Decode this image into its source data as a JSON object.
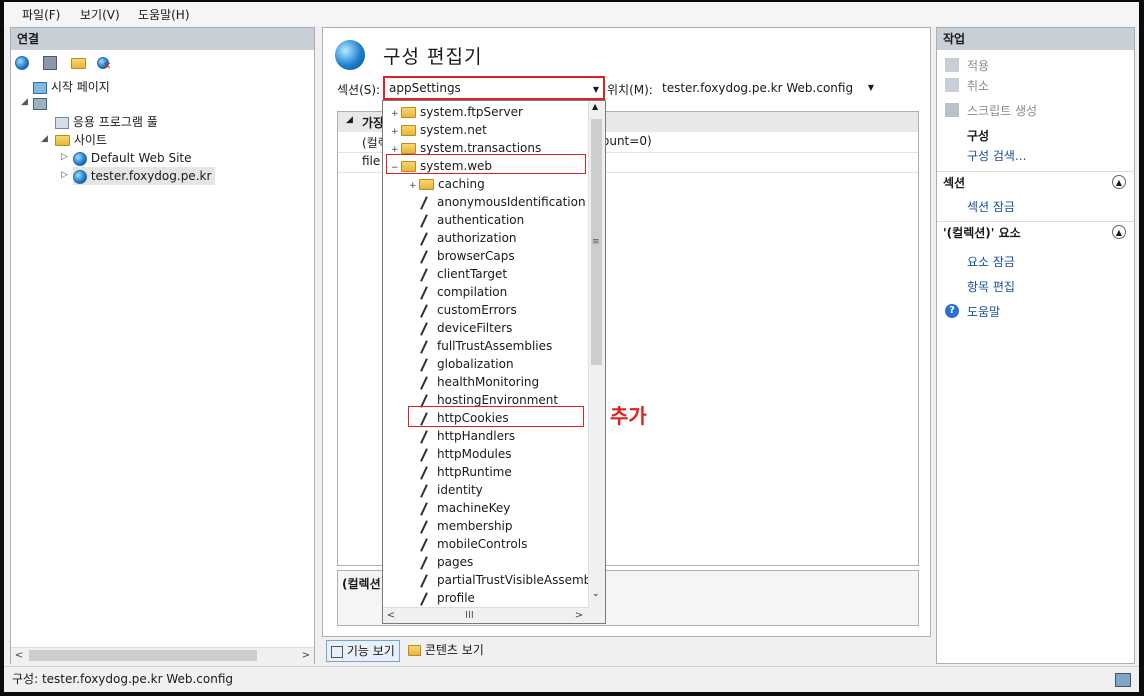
{
  "menu": [
    "파일(F)",
    "보기(V)",
    "도움말(H)"
  ],
  "connections": {
    "header": "연결",
    "tree": {
      "start_page": "시작 페이지",
      "app_pools": "응용 프로그램 풀",
      "sites": "사이트",
      "site1": "Default Web Site",
      "site2": "tester.foxydog.pe.kr"
    }
  },
  "center": {
    "title": "구성 편집기",
    "section_label": "섹션(S):",
    "section_value": "appSettings",
    "location_label": "위치(M):",
    "location_value": "tester.foxydog.pe.kr Web.config",
    "grid_header_partial": "가장",
    "grid_row1_partial": "(컬렉",
    "grid_row1_tail": "ount=0)",
    "grid_row2_partial": "file",
    "bottom_label": "(컬렉션)"
  },
  "dropdown": {
    "items_top": [
      "system.ftpServer",
      "system.net",
      "system.transactions",
      "system.web"
    ],
    "caching": "caching",
    "children": [
      "anonymousIdentification",
      "authentication",
      "authorization",
      "browserCaps",
      "clientTarget",
      "compilation",
      "customErrors",
      "deviceFilters",
      "fullTrustAssemblies",
      "globalization",
      "healthMonitoring",
      "hostingEnvironment",
      "httpCookies",
      "httpHandlers",
      "httpModules",
      "httpRuntime",
      "identity",
      "machineKey",
      "membership",
      "mobileControls",
      "pages",
      "partialTrustVisibleAssembli",
      "profile"
    ]
  },
  "annotation": "추가",
  "actions": {
    "header": "작업",
    "apply": "적용",
    "cancel": "취소",
    "generate_script": "스크립트 생성",
    "config_label": "구성",
    "search_config": "구성 검색...",
    "section_header": "섹션",
    "lock_section": "섹션 잠금",
    "collection_header": "'(컬렉션)' 요소",
    "lock_element": "요소 잠금",
    "edit_items": "항목 편집",
    "help": "도움말"
  },
  "tabs": {
    "features": "기능 보기",
    "content": "콘텐츠 보기"
  },
  "status": "구성: tester.foxydog.pe.kr Web.config",
  "colors": {
    "highlight": "#dd2222",
    "link": "#1a4f9c",
    "panel_head": "#c9cfd6"
  }
}
